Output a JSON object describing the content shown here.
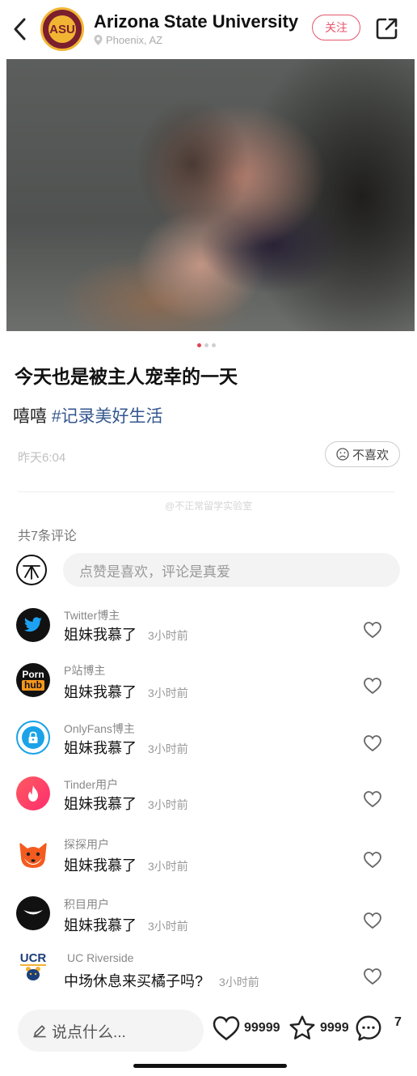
{
  "header": {
    "title": "Arizona State University",
    "location": "Phoenix, AZ",
    "avatar_text": "ASU",
    "follow_label": "关注"
  },
  "post": {
    "image_count_dots": 3,
    "title": "今天也是被主人宠幸的一天",
    "body_text": "嘻嘻 ",
    "hashtag": "#记录美好生活",
    "time": "昨天6:04",
    "dislike_label": "不喜欢",
    "watermark": "@不正常留学实验室"
  },
  "comments_section": {
    "count_label": "共7条评论",
    "input_placeholder": "点赞是喜欢，评论是真爱",
    "items": [
      {
        "name": "Twitter博主",
        "text": "姐妹我慕了",
        "time": "3小时前"
      },
      {
        "name": "P站博主",
        "text": "姐妹我慕了",
        "time": "3小时前",
        "logo_top": "Porn",
        "logo_bottom": "hub"
      },
      {
        "name": "OnlyFans博主",
        "text": "姐妹我慕了",
        "time": "3小时前"
      },
      {
        "name": "Tinder用户",
        "text": "姐妹我慕了",
        "time": "3小时前"
      },
      {
        "name": "探探用户",
        "text": "姐妹我慕了",
        "time": "3小时前"
      },
      {
        "name": "积目用户",
        "text": "姐妹我慕了",
        "time": "3小时前"
      },
      {
        "name": "UC Riverside",
        "text": "中场休息来买橘子吗?",
        "time": "3小时前",
        "logo_text": "UCR"
      }
    ]
  },
  "bottom_bar": {
    "say_placeholder": "说点什么...",
    "likes": "99999",
    "stars": "9999",
    "comments": "7"
  },
  "colors": {
    "accent_red": "#e4566d",
    "hashtag_blue": "#34578f"
  }
}
